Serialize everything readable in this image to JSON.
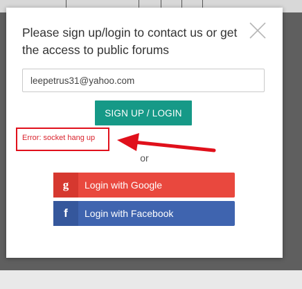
{
  "modal": {
    "title": "Please sign up/login to contact us or get the access to public forums",
    "email_value": "leepetrus31@yahoo.com",
    "signup_label": "SIGN UP / LOGIN",
    "error_text": "Error: socket hang up",
    "or_text": "or",
    "google_label": "Login with Google",
    "google_icon_glyph": "g",
    "facebook_label": "Login with Facebook",
    "facebook_icon_glyph": "f"
  },
  "colors": {
    "signup": "#169987",
    "error": "#e0101b",
    "google": "#e9483e",
    "facebook": "#3f64af"
  },
  "icons": {
    "close": "close-icon",
    "google": "google-icon",
    "facebook": "facebook-icon",
    "annotation": "red-arrow-icon"
  }
}
